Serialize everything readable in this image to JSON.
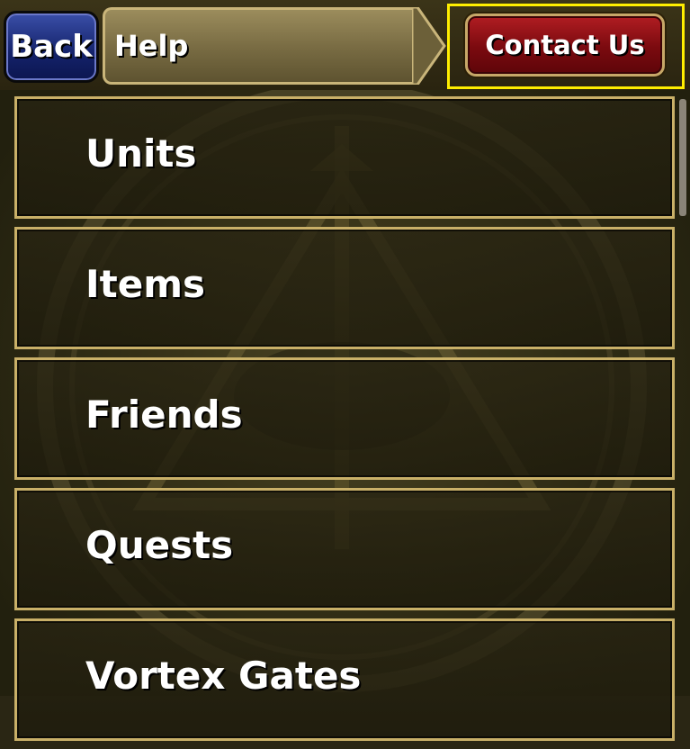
{
  "header": {
    "back_label": "Back",
    "title": "Help",
    "contact_label": "Contact Us"
  },
  "menu": {
    "items": [
      {
        "label": "Units"
      },
      {
        "label": "Items"
      },
      {
        "label": "Friends"
      },
      {
        "label": "Quests"
      },
      {
        "label": "Vortex Gates"
      }
    ]
  },
  "colors": {
    "back_button": "#14226a",
    "contact_button": "#7a0a0f",
    "frame_gold": "#c9b068",
    "highlight": "#ffee00"
  }
}
